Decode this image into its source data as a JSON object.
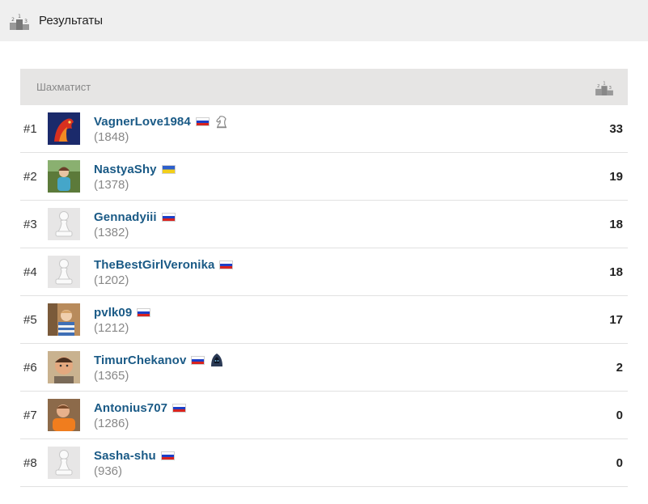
{
  "header": {
    "title": "Результаты",
    "icon": "podium-icon"
  },
  "table": {
    "col_player": "Шахматист",
    "col_score_icon": "podium-icon",
    "rows": [
      {
        "rank": "#1",
        "name": "VagnerLove1984",
        "rating": "(1848)",
        "score": "33",
        "flag": "ru",
        "avatar": "photo-horse",
        "badge": "knight-icon"
      },
      {
        "rank": "#2",
        "name": "NastyaShy",
        "rating": "(1378)",
        "score": "19",
        "flag": "ua",
        "avatar": "photo-girl",
        "badge": ""
      },
      {
        "rank": "#3",
        "name": "Gennadyiii",
        "rating": "(1382)",
        "score": "18",
        "flag": "ru",
        "avatar": "pawn",
        "badge": ""
      },
      {
        "rank": "#4",
        "name": "TheBestGirlVeronika",
        "rating": "(1202)",
        "score": "18",
        "flag": "ru",
        "avatar": "pawn",
        "badge": ""
      },
      {
        "rank": "#5",
        "name": "pvlk09",
        "rating": "(1212)",
        "score": "17",
        "flag": "ru",
        "avatar": "photo-kid",
        "badge": ""
      },
      {
        "rank": "#6",
        "name": "TimurChekanov",
        "rating": "(1365)",
        "score": "2",
        "flag": "ru",
        "avatar": "photo-boy",
        "badge": "hooded-icon"
      },
      {
        "rank": "#7",
        "name": "Antonius707",
        "rating": "(1286)",
        "score": "0",
        "flag": "ru",
        "avatar": "photo-orange",
        "badge": ""
      },
      {
        "rank": "#8",
        "name": "Sasha-shu",
        "rating": "(936)",
        "score": "0",
        "flag": "ru",
        "avatar": "pawn",
        "badge": ""
      }
    ]
  }
}
